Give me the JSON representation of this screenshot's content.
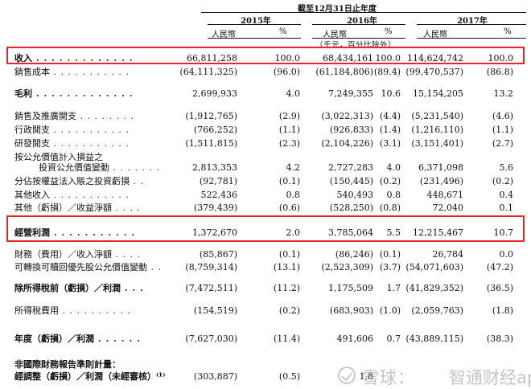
{
  "header": {
    "period": "截至12月31日止年度",
    "years": [
      "2015年",
      "2016年",
      "2017年"
    ],
    "currency": "人民幣",
    "pct": "%",
    "unit_note": "（千元，百分比除外）"
  },
  "rows": [
    {
      "label": "收入",
      "v15": "66,811,258",
      "p15": "100.0",
      "v16": "68,434,161",
      "p16": "100.0",
      "v17": "114,624,742",
      "p17": "100.0"
    },
    {
      "label": "銷售成本",
      "v15": "(64,111,325)",
      "p15": "(96.0)",
      "v16": "(61,184,806)",
      "p16": "(89.4)",
      "v17": "(99,470,537)",
      "p17": "(86.8)"
    },
    {
      "label": "毛利",
      "v15": "2,699,933",
      "p15": "4.0",
      "v16": "7,249,355",
      "p16": "10.6",
      "v17": "15,154,205",
      "p17": "13.2"
    },
    {
      "label": "銷售及推廣開支",
      "v15": "(1,912,765)",
      "p15": "(2.9)",
      "v16": "(3,022,313)",
      "p16": "(4.4)",
      "v17": "(5,231,540)",
      "p17": "(4.6)"
    },
    {
      "label": "行政開支",
      "v15": "(766,252)",
      "p15": "(1.1)",
      "v16": "(926,833)",
      "p16": "(1.4)",
      "v17": "(1,216,110)",
      "p17": "(1.1)"
    },
    {
      "label": "研發開支",
      "v15": "(1,511,815)",
      "p15": "(2.3)",
      "v16": "(2,104,226)",
      "p16": "(3.1)",
      "v17": "(3,151,401)",
      "p17": "(2.7)"
    },
    {
      "label": "按公允價值計入損益之",
      "v15": "",
      "p15": "",
      "v16": "",
      "p16": "",
      "v17": "",
      "p17": ""
    },
    {
      "label": "投資公允價值變動",
      "v15": "2,813,353",
      "p15": "4.2",
      "v16": "2,727,283",
      "p16": "4.0",
      "v17": "6,371,098",
      "p17": "5.6"
    },
    {
      "label": "分佔按權益法入賬之投資虧損",
      "v15": "(92,781)",
      "p15": "(0.1)",
      "v16": "(150,445)",
      "p16": "(0.2)",
      "v17": "(231,496)",
      "p17": "(0.2)"
    },
    {
      "label": "其他收入",
      "v15": "522,436",
      "p15": "0.8",
      "v16": "540,493",
      "p16": "0.8",
      "v17": "448,671",
      "p17": "0.4"
    },
    {
      "label": "其他（虧損）／收益淨額",
      "v15": "(379,439)",
      "p15": "(0.6)",
      "v16": "(528,250)",
      "p16": "(0.8)",
      "v17": "72,040",
      "p17": "0.1"
    },
    {
      "label": "經營利潤",
      "v15": "1,372,670",
      "p15": "2.0",
      "v16": "3,785,064",
      "p16": "5.5",
      "v17": "12,215,467",
      "p17": "10.7"
    },
    {
      "label": "財務（費用）／收入淨額",
      "v15": "(85,867)",
      "p15": "(0.1)",
      "v16": "(86,246)",
      "p16": "(0.1)",
      "v17": "26,784",
      "p17": "0.0"
    },
    {
      "label": "可轉換可贖回優先股公允價值變動",
      "v15": "(8,759,314)",
      "p15": "(13.1)",
      "v16": "(2,523,309)",
      "p16": "(3.7)",
      "v17": "(54,071,603)",
      "p17": "(47.2)"
    },
    {
      "label": "除所得稅前（虧損）／利潤",
      "v15": "(7,472,511)",
      "p15": "(11.2)",
      "v16": "1,175,509",
      "p16": "1.7",
      "v17": "(41,829,352)",
      "p17": "(36.5)"
    },
    {
      "label": "所得稅費用",
      "v15": "(154,519)",
      "p15": "(0.2)",
      "v16": "(683,903)",
      "p16": "(1.0)",
      "v17": "(2,059,763)",
      "p17": "(1.8)"
    },
    {
      "label": "年度（虧損）／利潤",
      "v15": "(7,627,030)",
      "p15": "(11.4)",
      "v16": "491,606",
      "p16": "0.7",
      "v17": "(43,889,115)",
      "p17": "(38.3)"
    },
    {
      "label": "非國際財務報告準則計量：",
      "v15": "",
      "p15": "",
      "v16": "",
      "p16": "",
      "v17": "",
      "p17": ""
    },
    {
      "label": "經調整（虧損）／利潤（未經審核）⁽¹⁾",
      "v15": "(303,887)",
      "p15": "(0.5)",
      "v16": "1,8",
      "p16": "",
      "v17": "",
      "p17": ""
    }
  ],
  "watermark": {
    "text_a": "雪球：",
    "text_b": "智通财经app"
  },
  "colors": {
    "highlight": "#e8262b"
  }
}
